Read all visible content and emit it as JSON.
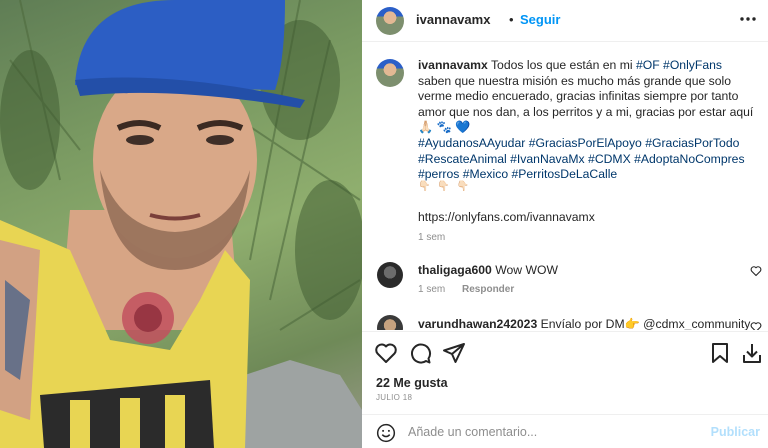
{
  "header": {
    "username": "ivannavamx",
    "separator": "•",
    "follow_label": "Seguir"
  },
  "caption": {
    "username": "ivannavamx",
    "text_intro": "Todos los que están en mi",
    "tag_of": "#OF",
    "tag_onlyfans": "#OnlyFans",
    "text_body": "saben que nuestra misión es mucho más grande que solo verme medio encuerado, gracias infinitas siempre por tanto amor que nos dan, a los perritos y a mi, gracias por estar aquí 🙏🏻 🐾 💙",
    "hashtags": [
      "#AyudanosAAyudar",
      "#GraciasPorElApoyo",
      "#GraciasPorTodo",
      "#RescateAnimal",
      "#IvanNavaMx",
      "#CDMX",
      "#AdoptaNoCompres",
      "#perros",
      "#Mexico",
      "#PerritosDeLaCalle"
    ],
    "emojis": "👇🏻 👇🏻 👇🏻",
    "url": "https://onlyfans.com/ivannavamx",
    "time": "1 sem"
  },
  "comments": [
    {
      "username": "thaligaga600",
      "text": "Wow WOW",
      "time": "1 sem",
      "reply_label": "Responder"
    },
    {
      "username": "varundhawan242023",
      "text": "Envíalo por DM👉 @cdmx_community"
    }
  ],
  "actions": {
    "like_icon": "heart-icon",
    "comment_icon": "comment-icon",
    "share_icon": "share-icon",
    "save_icon": "bookmark-icon",
    "download_icon": "download-icon"
  },
  "likes_text": "22 Me gusta",
  "date_text": "JULIO 18",
  "add_comment": {
    "placeholder": "Añade un comentario...",
    "post_label": "Publicar"
  },
  "colors": {
    "accent": "#0095f6",
    "hashtag": "#00376b",
    "muted": "#8e8e8e",
    "post_disabled": "#b2dffc"
  }
}
